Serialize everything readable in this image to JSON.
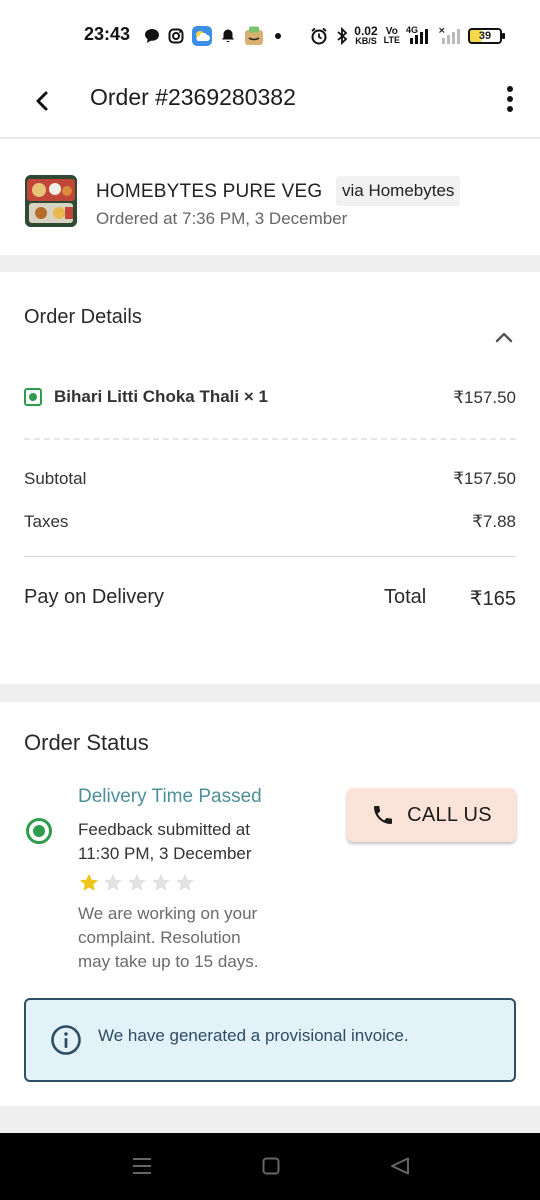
{
  "status_bar": {
    "time": "23:43",
    "net_speed_top": "0.02",
    "net_speed_bottom": "KB/S",
    "volte_top": "Vo",
    "volte_bottom": "LTE",
    "network": "4G",
    "battery": "39",
    "icons": [
      "chat-icon",
      "instagram-icon",
      "weather-icon",
      "notification-bell-icon",
      "amazon-icon",
      "dot-icon",
      "alarm-icon",
      "bluetooth-icon",
      "signal-icon",
      "signal-weak-icon",
      "battery-icon"
    ]
  },
  "app_bar": {
    "title": "Order #2369280382",
    "icons": [
      "back-arrow-icon",
      "more-vertical-icon"
    ]
  },
  "restaurant": {
    "name": "HOMEBYTES PURE VEG",
    "via": "via Homebytes",
    "ordered_at": "Ordered at 7:36 PM, 3 December"
  },
  "order_details": {
    "title": "Order Details",
    "items": [
      {
        "name": "Bihari Litti Choka Thali × 1",
        "price": "₹157.50"
      }
    ],
    "subtotal_label": "Subtotal",
    "subtotal": "₹157.50",
    "taxes_label": "Taxes",
    "taxes": "₹7.88",
    "payment_method": "Pay on Delivery",
    "total_label": "Total",
    "total": "₹165"
  },
  "order_status": {
    "title": "Order Status",
    "heading": "Delivery Time Passed",
    "feedback_line1": "Feedback submitted at",
    "feedback_line2": "11:30 PM, 3 December",
    "rating": 1,
    "rating_max": 5,
    "note_line1": "We are working on your",
    "note_line2": "complaint. Resolution",
    "note_line3": "may take up to 15 days.",
    "call_button": "CALL US",
    "info_text": "We have generated a provisional invoice."
  },
  "colors": {
    "accent_green": "#2e9c4a",
    "status_teal": "#4e8f9c",
    "call_button_bg": "#fbe3d9",
    "info_bg": "#e3f2f8",
    "info_border": "#2f4f63",
    "star_filled": "#f0c419",
    "star_empty": "#e2e2e2"
  }
}
